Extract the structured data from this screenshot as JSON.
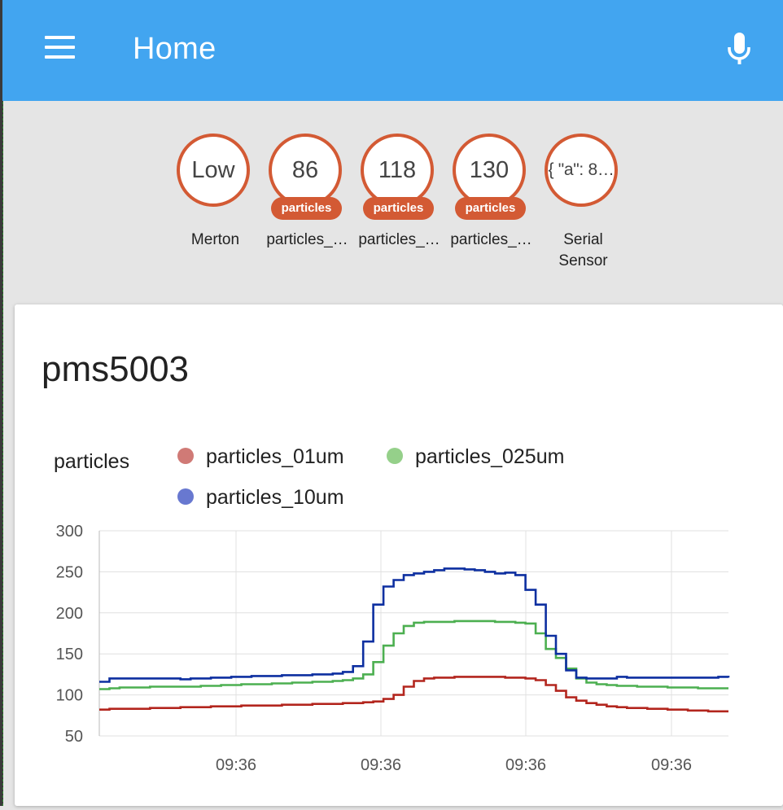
{
  "header": {
    "title": "Home",
    "menu_icon": "hamburger-menu-icon",
    "mic_icon": "microphone-icon",
    "color": "#42a5f0"
  },
  "badges": [
    {
      "value": "Low",
      "unit": "",
      "label": "Merton"
    },
    {
      "value": "86",
      "unit": "particles",
      "label": "particles_…"
    },
    {
      "value": "118",
      "unit": "particles",
      "label": "particles_…"
    },
    {
      "value": "130",
      "unit": "particles",
      "label": "particles_…"
    },
    {
      "value": "{ \"a\": 8…",
      "unit": "",
      "label": "Serial Sensor"
    }
  ],
  "card": {
    "title": "pms5003"
  },
  "chart_data": {
    "type": "line",
    "ylabel": "particles",
    "ylim": [
      50,
      300
    ],
    "yticks": [
      300,
      250,
      200,
      150,
      100,
      50
    ],
    "xtick_labels": [
      "09:36",
      "09:36",
      "09:36",
      "09:36"
    ],
    "grid": true,
    "legend_placement": "top",
    "series": [
      {
        "name": "particles_01um",
        "color": "#b3261e",
        "legend_color": "#d07a76",
        "values": [
          82,
          83,
          83,
          83,
          83,
          84,
          84,
          84,
          85,
          85,
          85,
          86,
          86,
          86,
          87,
          87,
          87,
          87,
          88,
          88,
          88,
          89,
          89,
          89,
          90,
          90,
          91,
          92,
          95,
          100,
          110,
          117,
          120,
          121,
          121,
          122,
          122,
          122,
          122,
          122,
          121,
          121,
          120,
          118,
          112,
          105,
          97,
          93,
          90,
          88,
          86,
          85,
          84,
          84,
          83,
          83,
          82,
          82,
          81,
          81,
          80,
          80,
          80
        ]
      },
      {
        "name": "particles_025um",
        "color": "#4caf50",
        "legend_color": "#95d08a",
        "values": [
          107,
          108,
          109,
          109,
          109,
          110,
          110,
          110,
          110,
          110,
          111,
          111,
          112,
          112,
          113,
          113,
          113,
          114,
          114,
          115,
          115,
          116,
          116,
          117,
          118,
          120,
          125,
          140,
          160,
          175,
          184,
          188,
          189,
          189,
          189,
          190,
          190,
          190,
          190,
          189,
          189,
          188,
          187,
          175,
          156,
          145,
          132,
          120,
          115,
          113,
          112,
          111,
          111,
          110,
          110,
          110,
          109,
          109,
          109,
          108,
          108,
          108,
          108
        ]
      },
      {
        "name": "particles_10um",
        "color": "#0d2fa0",
        "legend_color": "#6878d0",
        "values": [
          116,
          120,
          120,
          120,
          120,
          120,
          120,
          120,
          119,
          120,
          120,
          121,
          121,
          122,
          122,
          123,
          123,
          123,
          124,
          124,
          124,
          125,
          125,
          126,
          128,
          135,
          165,
          210,
          232,
          240,
          246,
          248,
          250,
          252,
          254,
          254,
          253,
          252,
          250,
          248,
          249,
          246,
          228,
          210,
          172,
          150,
          130,
          121,
          120,
          120,
          120,
          122,
          121,
          121,
          121,
          121,
          121,
          121,
          121,
          121,
          121,
          122,
          121
        ]
      }
    ]
  }
}
